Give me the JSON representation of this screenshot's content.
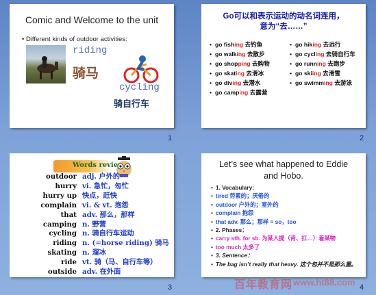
{
  "slides": [
    {
      "number": "1",
      "title": "Comic and Welcome to the unit",
      "bullet": "• Different kinds of outdoor activities:",
      "riding_en": "riding",
      "riding_cn": "骑马",
      "cycling_en": "cycling",
      "cycling_cn": "骑自行车"
    },
    {
      "number": "2",
      "title_line1": "Go可以和表示运动的动名词连用，",
      "title_line2": "意为“去……”",
      "left_items": [
        {
          "pre": "go fish",
          "hl": "ing",
          "post": " 去钓鱼"
        },
        {
          "pre": "go walk",
          "hl": "ing",
          "post": " 去散步"
        },
        {
          "pre": "go shop",
          "hl": "ping",
          "post": " 去购物"
        },
        {
          "pre": "go skat",
          "hl": "ing",
          "post": " 去滑冰"
        },
        {
          "pre": "go div",
          "hl": "ing",
          "post": " 去潜水"
        },
        {
          "pre": "go camp",
          "hl": "ing",
          "post": " 去露营"
        }
      ],
      "right_items": [
        {
          "pre": "go hik",
          "hl": "ing",
          "post": " 去远行"
        },
        {
          "pre": "go cycl",
          "hl": "ing",
          "post": " 去骑自行车"
        },
        {
          "pre": "go runn",
          "hl": "ing",
          "post": " 去跑步"
        },
        {
          "pre": "go ski",
          "hl": "ing",
          "post": " 去滑雪"
        },
        {
          "pre": "go swimm",
          "hl": "ing",
          "post": " 去游泳"
        }
      ]
    },
    {
      "number": "3",
      "badge": "Words review",
      "words": [
        {
          "w": "outdoor",
          "d": "adj. 户外的"
        },
        {
          "w": "hurry",
          "d": "vi. 急忙，匆忙"
        },
        {
          "w": "hurry up",
          "d": "快点，赶快"
        },
        {
          "w": "complain",
          "d": "vi. & vt. 抱怨"
        },
        {
          "w": "that",
          "d": "adv. 那么，那样"
        },
        {
          "w": "camping",
          "d": "n. 野营"
        },
        {
          "w": "cycling",
          "d": "n. 骑自行车运动"
        },
        {
          "w": "riding",
          "d": "n. (=horse riding) 骑马"
        },
        {
          "w": "skating",
          "d": "n. 溜冰"
        },
        {
          "w": "ride",
          "d": "vt. 骑（马、自行车等）"
        },
        {
          "w": "outside",
          "d": "adv. 在外面"
        }
      ]
    },
    {
      "number": "4",
      "title_line1": "Let’s see what happened to Eddie",
      "title_line2": "and Hobo.",
      "items": [
        {
          "style": "c-black",
          "text": "1. Vocabulary:"
        },
        {
          "style": "c-blue",
          "text": "tired 劳累的；厌倦的"
        },
        {
          "style": "c-blue",
          "text": "outdoor 户外的；室外的"
        },
        {
          "style": "c-blue",
          "text": "complain 抱怨"
        },
        {
          "style": "c-blue",
          "text": "that adv. 那么；那样 = so，too"
        },
        {
          "style": "c-black",
          "text": "2. Phases："
        },
        {
          "style": "c-pink",
          "text": "carry sth. for sb. 为某人提（背、扛…）着某物"
        },
        {
          "style": "c-pink",
          "text": "too much 太多了"
        },
        {
          "style": "c-it",
          "text": "3. Sentence："
        },
        {
          "style": "c-it",
          "text": "The bag isn’t really that heavy. 这个包并不是那么重。"
        }
      ]
    }
  ],
  "watermark": "百年教育网",
  "watermark_url": "www.ht88.com"
}
